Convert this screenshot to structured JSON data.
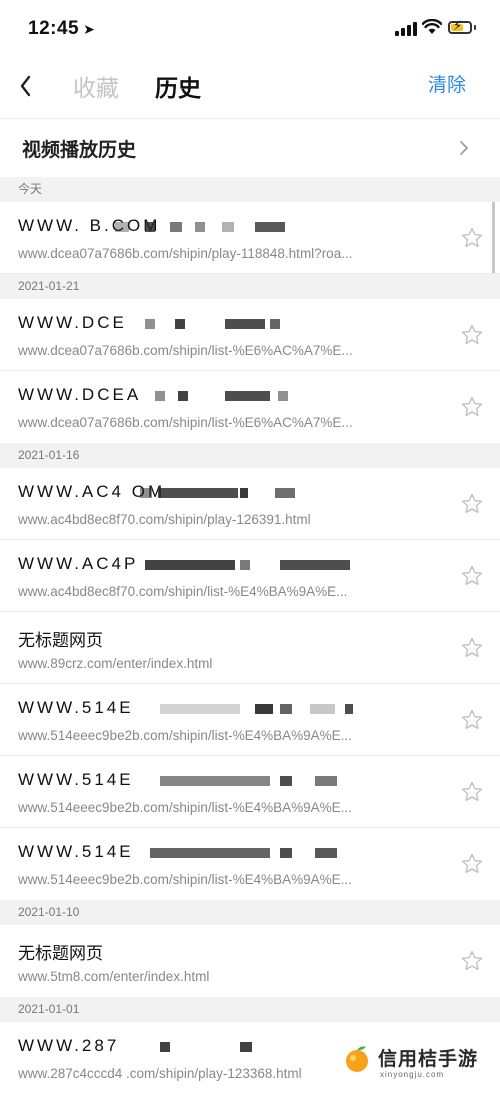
{
  "status_bar": {
    "time": "12:45"
  },
  "header": {
    "tabs": [
      {
        "label": "收藏"
      },
      {
        "label": "历史"
      }
    ],
    "clear_label": "清除"
  },
  "section": {
    "title": "视频播放历史"
  },
  "groups": [
    {
      "date": "今天",
      "entries": [
        {
          "title": "WWW.            B.COM",
          "url": "www.dcea07a7686b.com/shipin/play-118848.html?roa..."
        }
      ]
    },
    {
      "date": "2021-01-21",
      "entries": [
        {
          "title": "WWW.DCE",
          "url": "www.dcea07a7686b.com/shipin/list-%E6%AC%A7%E..."
        },
        {
          "title": "WWW.DCEA",
          "url": "www.dcea07a7686b.com/shipin/list-%E6%AC%A7%E..."
        }
      ]
    },
    {
      "date": "2021-01-16",
      "entries": [
        {
          "title": "WWW.AC4                  OM",
          "url": "www.ac4bd8ec8f70.com/shipin/play-126391.html"
        },
        {
          "title": "WWW.AC4P",
          "url": "www.ac4bd8ec8f70.com/shipin/list-%E4%BA%9A%E..."
        },
        {
          "title": "无标题网页",
          "url": "www.89crz.com/enter/index.html"
        },
        {
          "title": "WWW.514E",
          "url": "www.514eeec9be2b.com/shipin/list-%E4%BA%9A%E..."
        },
        {
          "title": "WWW.514E",
          "url": "www.514eeec9be2b.com/shipin/list-%E4%BA%9A%E..."
        },
        {
          "title": "WWW.514E",
          "url": "www.514eeec9be2b.com/shipin/list-%E4%BA%9A%E..."
        }
      ]
    },
    {
      "date": "2021-01-10",
      "entries": [
        {
          "title": "无标题网页",
          "url": "www.5tm8.com/enter/index.html"
        }
      ]
    },
    {
      "date": "2021-01-01",
      "entries": [
        {
          "title": "WWW.287",
          "url": "www.287c4cccd4 .com/shipin/play-123368.html"
        }
      ]
    }
  ],
  "watermark": {
    "title": "信用桔手游",
    "subtitle": "xinyongju.com"
  },
  "colors": {
    "accent": "#2a8ce8",
    "muted_tab": "#c4c4c4",
    "date_bg": "#f2f2f2"
  },
  "icons": [
    "back-chevron-icon",
    "chevron-right-icon",
    "star-outline-icon",
    "signal-icon",
    "wifi-icon",
    "battery-icon"
  ]
}
